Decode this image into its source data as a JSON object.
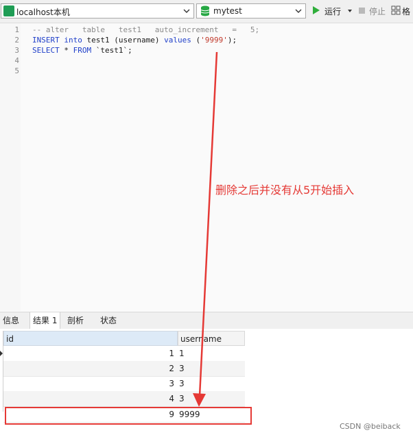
{
  "toolbar": {
    "connection": "localhost本机",
    "database": "mytest",
    "run_label": "运行",
    "stop_label": "停止",
    "format_label": "格"
  },
  "editor": {
    "line_numbers": [
      "1",
      "2",
      "3",
      "4",
      "5"
    ]
  },
  "tabs": [
    "信息",
    "结果 1",
    "剖析",
    "状态"
  ],
  "grid": {
    "columns": [
      "id",
      "username"
    ],
    "rows": [
      {
        "id": "1",
        "username": "1"
      },
      {
        "id": "2",
        "username": "3"
      },
      {
        "id": "3",
        "username": "3"
      },
      {
        "id": "4",
        "username": "3"
      },
      {
        "id": "9",
        "username": "9999"
      }
    ]
  },
  "annotation": "删除之后并没有从5开始插入",
  "watermark": "CSDN @beiback",
  "colors": {
    "annotation": "#e53935",
    "run_icon": "#2fae3b",
    "keyword": "#1f3fc9",
    "string": "#c0392b"
  }
}
